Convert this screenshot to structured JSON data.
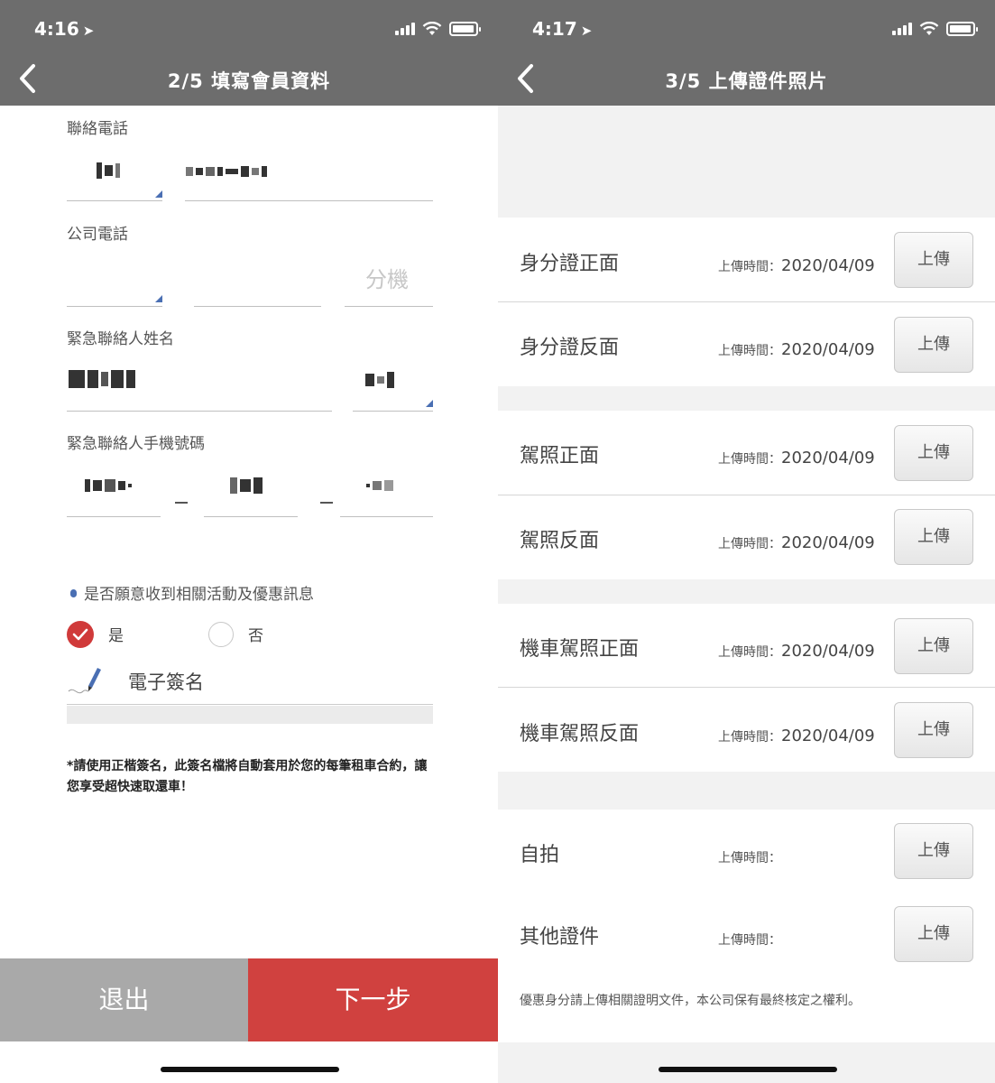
{
  "left": {
    "status_time": "4:16",
    "title": "2/5 填寫會員資料",
    "contact_phone_label": "聯絡電話",
    "company_phone_label": "公司電話",
    "extension_placeholder": "分機",
    "emergency_name_label": "緊急聯絡人姓名",
    "emergency_mobile_label": "緊急聯絡人手機號碼",
    "promo_question": "是否願意收到相關活動及優惠訊息",
    "option_yes": "是",
    "option_no": "否",
    "promo_selected": "是",
    "signature_label": "電子簽名",
    "note": "*請使用正楷簽名，此簽名檔將自動套用於您的每筆租車合約，讓您享受超快速取還車！",
    "exit_button": "退出",
    "next_button": "下一步"
  },
  "right": {
    "status_time": "4:17",
    "title": "3/5 上傳證件照片",
    "upload_time_label": "上傳時間：",
    "upload_button": "上傳",
    "documents": [
      {
        "name": "身分證正面",
        "date": "2020/04/09"
      },
      {
        "name": "身分證反面",
        "date": "2020/04/09"
      },
      {
        "name": "駕照正面",
        "date": "2020/04/09"
      },
      {
        "name": "駕照反面",
        "date": "2020/04/09"
      },
      {
        "name": "機車駕照正面",
        "date": "2020/04/09"
      },
      {
        "name": "機車駕照反面",
        "date": "2020/04/09"
      },
      {
        "name": "自拍",
        "date": ""
      },
      {
        "name": "其他證件",
        "date": ""
      }
    ],
    "footnote": "優惠身分請上傳相關證明文件，本公司保有最終核定之權利。"
  },
  "colors": {
    "header_gray": "#6d6d6d",
    "accent_red": "#d0413f",
    "exit_gray": "#a9a9a9",
    "dropdown_blue": "#4a6fb3"
  },
  "icons": {
    "back": "chevron-left-icon",
    "location": "location-arrow-icon",
    "signal": "cellular-signal-icon",
    "wifi": "wifi-icon",
    "battery": "battery-icon",
    "check": "check-icon",
    "pen": "pen-icon"
  }
}
